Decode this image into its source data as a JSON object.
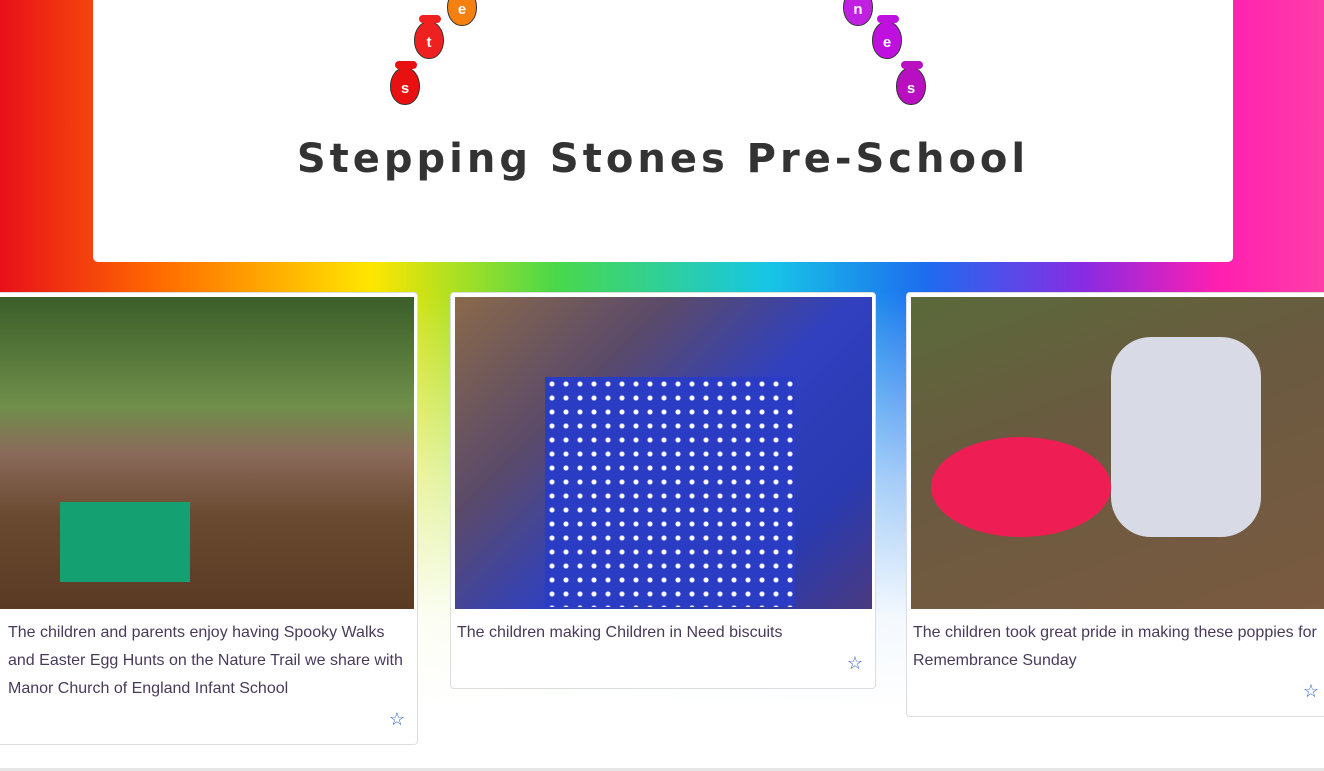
{
  "header": {
    "logo_letters": [
      "s",
      "t",
      "e",
      "n",
      "e",
      "s"
    ],
    "title": "Stepping Stones Pre-School",
    "logo_colors": [
      "#e81010",
      "#ee2020",
      "#f5800f",
      "#c020e0",
      "#c010e0",
      "#b810c0"
    ]
  },
  "cards": [
    {
      "caption": "The children and parents enjoy having Spooky Walks and Easter Egg Hunts on the Nature Trail we share with Manor Church of England Infant School",
      "icon": "star-outline-icon"
    },
    {
      "caption": "The children making Children in Need biscuits",
      "icon": "star-outline-icon"
    },
    {
      "caption": "The children took great pride in making these poppies for Remembrance Sunday",
      "icon": "star-outline-icon"
    }
  ],
  "colors": {
    "star": "#2a62c9",
    "caption": "#4a3a5a"
  }
}
